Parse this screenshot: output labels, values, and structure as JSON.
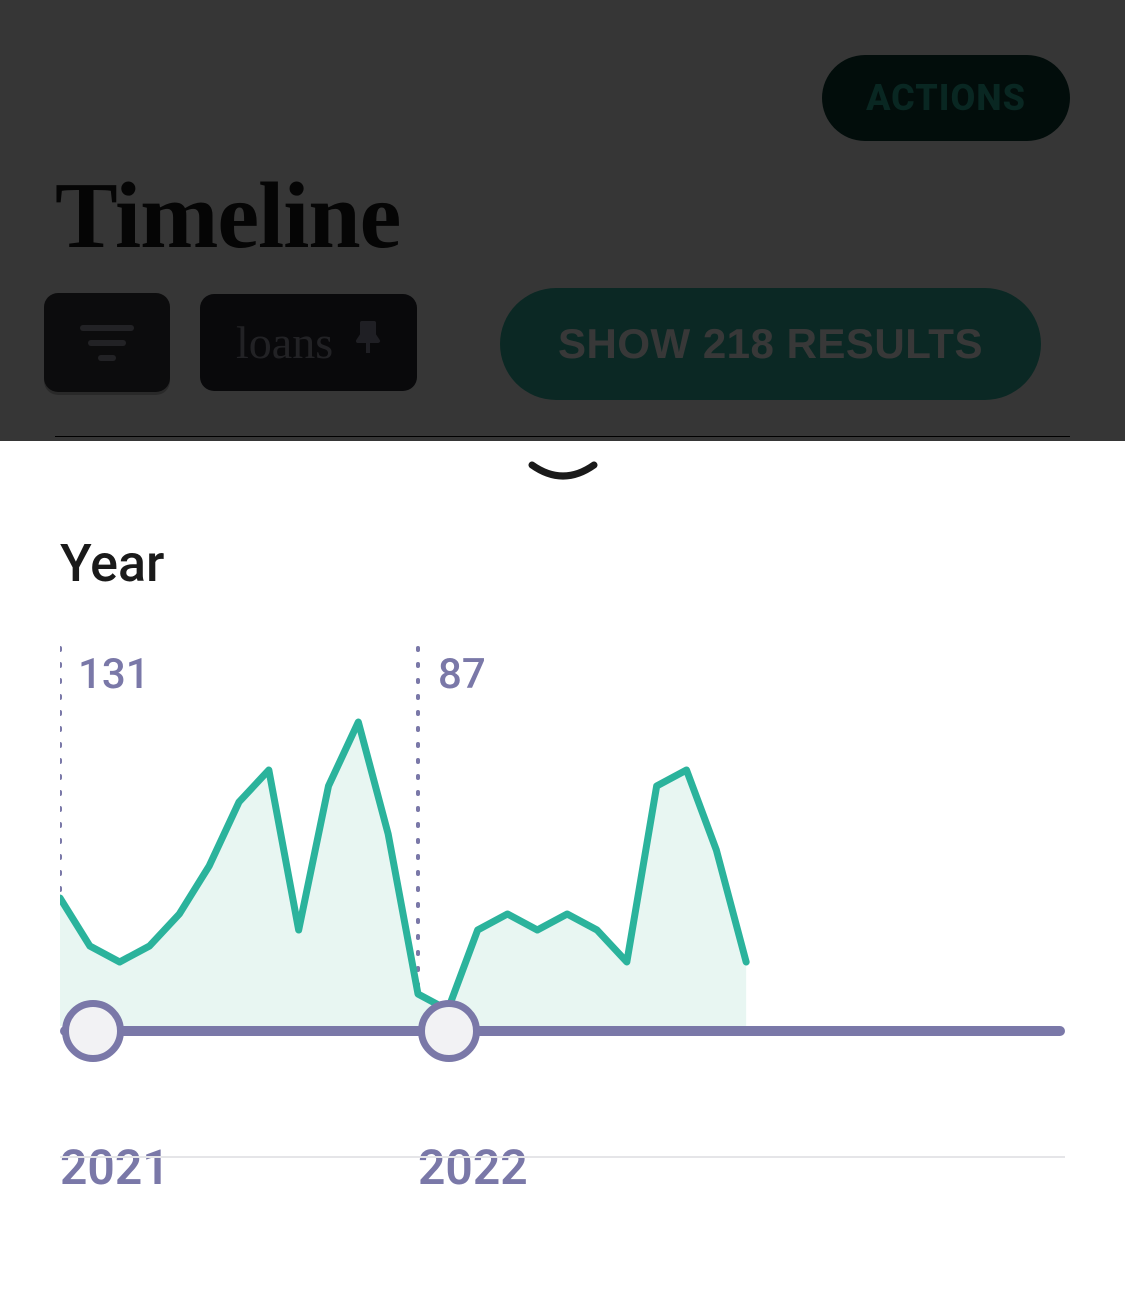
{
  "header": {
    "actions_label": "ACTIONS",
    "title": "Timeline"
  },
  "filters": {
    "chip_label": "loans",
    "show_results_label": "SHOW 218 RESULTS",
    "results_count": 218
  },
  "sheet": {
    "section_title": "Year",
    "counts": {
      "y2021": "131",
      "y2022": "87"
    },
    "years": {
      "left": "2021",
      "right": "2022"
    }
  },
  "chart_data": {
    "type": "area",
    "title": "",
    "xlabel": "",
    "ylabel": "",
    "ylim": [
      0,
      20
    ],
    "x": [
      "2021-01",
      "2021-02",
      "2021-03",
      "2021-04",
      "2021-05",
      "2021-06",
      "2021-07",
      "2021-08",
      "2021-09",
      "2021-10",
      "2021-11",
      "2021-12",
      "2022-01",
      "2022-02",
      "2022-03",
      "2022-04",
      "2022-05",
      "2022-06",
      "2022-07",
      "2022-08",
      "2022-09",
      "2022-10",
      "2022-11",
      "2022-12"
    ],
    "values": [
      8,
      5,
      4,
      5,
      7,
      10,
      14,
      16,
      6,
      15,
      19,
      12,
      2,
      1,
      6,
      7,
      6,
      7,
      6,
      4,
      15,
      16,
      11,
      4
    ],
    "year_totals": {
      "2021": 131,
      "2022": 87
    },
    "year_boundaries": [
      "2021",
      "2022"
    ]
  }
}
